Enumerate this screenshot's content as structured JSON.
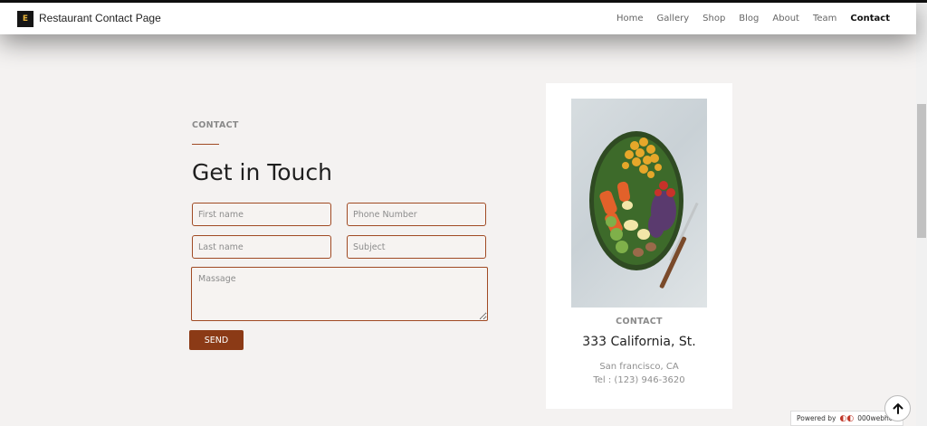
{
  "brand": {
    "logo_letter": "E",
    "title": "Restaurant Contact Page"
  },
  "nav": {
    "items": [
      "Home",
      "Gallery",
      "Shop",
      "Blog",
      "About",
      "Team",
      "Contact"
    ],
    "active": "Contact"
  },
  "form": {
    "eyebrow": "CONTACT",
    "heading": "Get in Touch",
    "first_name_placeholder": "First name",
    "phone_placeholder": "Phone Number",
    "last_name_placeholder": "Last name",
    "subject_placeholder": "Subject",
    "message_placeholder": "Massage",
    "send_label": "SEND"
  },
  "card": {
    "image_icon": "salad-bowl-photo",
    "eyebrow": "CONTACT",
    "address": "333 California, St.",
    "city": "San francisco, CA",
    "tel": "Tel : (123) 946-3620"
  },
  "footer": {
    "powered_prefix": "Powered by",
    "powered_brand": "000webhost",
    "up_icon": "arrow-up-icon"
  },
  "colors": {
    "accent": "#a04a23",
    "button": "#8b3a16",
    "background": "#f4f2f1"
  }
}
